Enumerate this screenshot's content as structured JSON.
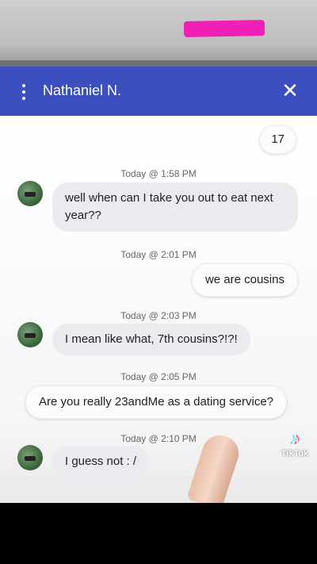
{
  "header": {
    "contact_name": "Nathaniel N.",
    "menu_icon": "kebab-menu-icon",
    "close_icon": "close-icon",
    "background_color": "#3b4fbf"
  },
  "messages": [
    {
      "direction": "outgoing",
      "text": "17"
    },
    {
      "timestamp": "Today @ 1:58 PM",
      "direction": "incoming",
      "text": "well when can I take you out to eat next year??"
    },
    {
      "timestamp": "Today @ 2:01 PM",
      "direction": "outgoing",
      "text": "we are cousins"
    },
    {
      "timestamp": "Today @ 2:03 PM",
      "direction": "incoming",
      "text": "I mean like what, 7th cousins?!?!"
    },
    {
      "timestamp": "Today @ 2:05 PM",
      "direction": "outgoing",
      "text": "Are you really 23andMe as a dating service?"
    },
    {
      "timestamp": "Today @ 2:10 PM",
      "direction": "incoming",
      "text": "I guess not : /"
    }
  ],
  "watermark": {
    "label": "TikTok",
    "icon": "tiktok-logo-icon"
  }
}
